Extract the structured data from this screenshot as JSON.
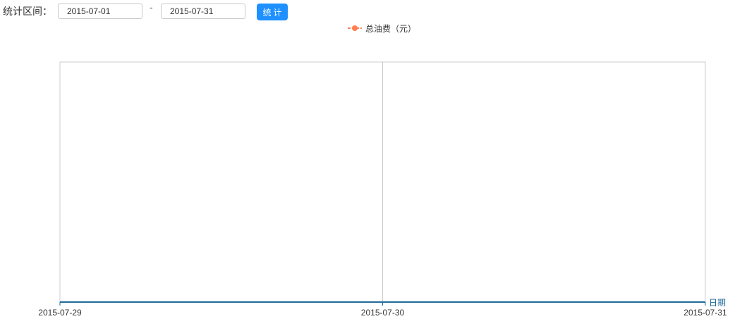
{
  "filter": {
    "range_label": "统计区间：",
    "start_date": "2015-07-01",
    "separator": "-",
    "end_date": "2015-07-31",
    "submit_label": "统计"
  },
  "chart_data": {
    "type": "line",
    "legend": [
      "总油费（元）"
    ],
    "legend_position": "top-center",
    "xlabel": "日期",
    "categories": [
      "2015-07-29",
      "2015-07-30",
      "2015-07-31"
    ],
    "series": [
      {
        "name": "总油费（元）",
        "color": "#ff7f50",
        "values": []
      }
    ],
    "grid": true,
    "colors": {
      "axis": "#1f6b9a",
      "grid": "#cccccc",
      "series": "#ff7f50",
      "button": "#1e90ff"
    }
  }
}
